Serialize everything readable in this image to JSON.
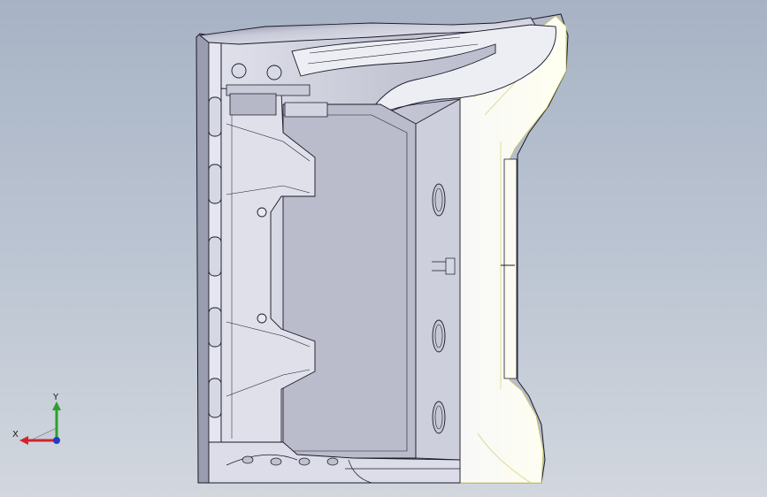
{
  "viewport": {
    "background_top": "#a7b3c5",
    "background_bottom": "#d2d7de",
    "model_fill": "#c6c8d6",
    "model_edge": "#1a1a2a",
    "highlight_fill": "#fbfbe8",
    "highlight_edge": "#e0e08a"
  },
  "triad": {
    "x_label": "X",
    "y_label": "Y",
    "x_color": "#d2242a",
    "y_color": "#2ca02c",
    "z_color": "#1f3fbf"
  }
}
